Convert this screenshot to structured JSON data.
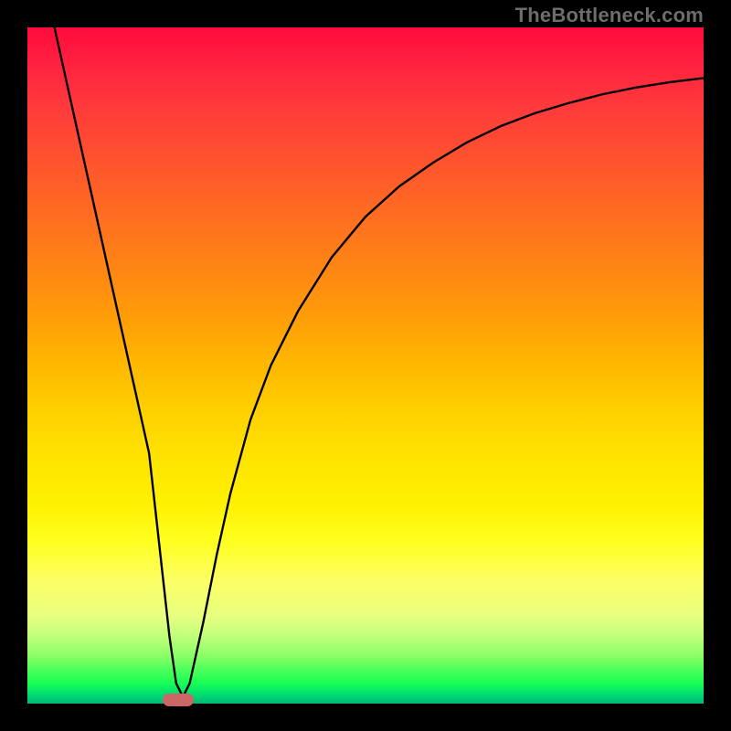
{
  "watermark": "TheBottleneck.com",
  "colors": {
    "curve": "#000000",
    "marker": "#cc6666",
    "bg_frame": "#000000"
  },
  "chart_data": {
    "type": "line",
    "title": "",
    "xlabel": "",
    "ylabel": "",
    "xlim": [
      0,
      100
    ],
    "ylim": [
      0,
      100
    ],
    "grid": false,
    "legend": false,
    "note": "No axis ticks or labels are rendered in the image. Values are estimated from pixel positions: x and y run 0–100 over the plot area; y=0 is bottom, y=100 is top.",
    "series": [
      {
        "name": "curve",
        "x": [
          4,
          6,
          8,
          10,
          12,
          14,
          16,
          18,
          20,
          21,
          22,
          23,
          24,
          26,
          28,
          30,
          33,
          36,
          40,
          45,
          50,
          55,
          60,
          65,
          70,
          75,
          80,
          85,
          90,
          95,
          100
        ],
        "y": [
          100,
          91,
          82,
          73,
          64,
          55,
          46,
          37,
          19,
          10,
          3,
          1,
          3,
          12,
          22,
          31,
          42,
          50,
          58,
          66,
          72,
          76.5,
          80,
          83,
          85.4,
          87.3,
          88.8,
          90.1,
          91.1,
          91.9,
          92.5
        ]
      }
    ],
    "annotations": [
      {
        "name": "minimum-marker",
        "x": 22.3,
        "y": 0.5,
        "shape": "pill",
        "color": "#cc6666"
      }
    ],
    "background_gradient": {
      "direction": "vertical",
      "stops": [
        {
          "pos": 0,
          "color": "#ff0b3c"
        },
        {
          "pos": 50,
          "color": "#ffb800"
        },
        {
          "pos": 80,
          "color": "#ffff20"
        },
        {
          "pos": 100,
          "color": "#00b877"
        }
      ]
    }
  }
}
